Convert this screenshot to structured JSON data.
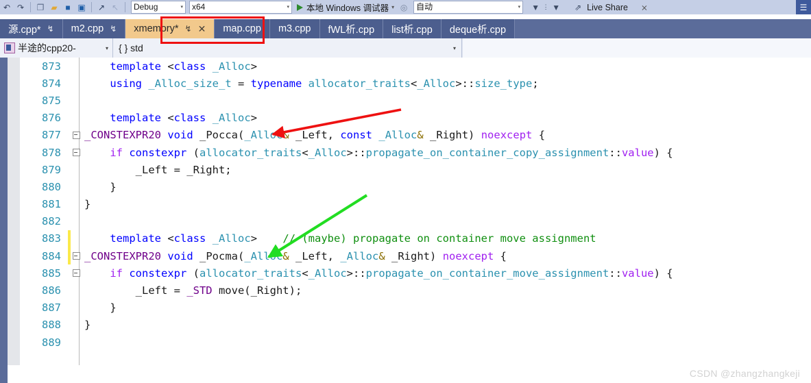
{
  "toolbar": {
    "config_combo": {
      "value": "Debug",
      "caret": "▾"
    },
    "platform_combo": {
      "value": "x64",
      "caret": "▾"
    },
    "run_label": "本地 Windows 调试器",
    "run_caret": "▾",
    "auto_combo": {
      "value": "自动",
      "caret": "▾"
    },
    "live_share_label": "Live Share",
    "icons": {
      "undo": "↶",
      "redo": "↷",
      "new_file": "❐",
      "open_folder": "▮",
      "save": "■",
      "save_all": "▣",
      "nav_forward": "↗",
      "nav_back": "↖",
      "shield": "◎",
      "filter_down": "▼",
      "dots": "⋮",
      "filter_down2": "▼",
      "share": "↗",
      "person": "✠",
      "menu": "≡"
    }
  },
  "tabs": [
    {
      "label": "源.cpp*",
      "pin": "↯",
      "close": "",
      "active": false
    },
    {
      "label": "m2.cpp",
      "pin": "↯",
      "close": "",
      "active": false
    },
    {
      "label": "xmemory*",
      "pin": "↯",
      "close": "✕",
      "active": true
    },
    {
      "label": "map.cpp",
      "pin": "",
      "close": "",
      "active": false
    },
    {
      "label": "m3.cpp",
      "pin": "",
      "close": "",
      "active": false
    },
    {
      "label": "fWL析.cpp",
      "pin": "",
      "close": "",
      "active": false
    },
    {
      "label": "list析.cpp",
      "pin": "",
      "close": "",
      "active": false
    },
    {
      "label": "deque析.cpp",
      "pin": "",
      "close": "",
      "active": false
    }
  ],
  "navbar": {
    "project": "半途的cpp20-",
    "project_caret": "▾",
    "scope": "{ } std",
    "scope_caret": "▾"
  },
  "code": {
    "lines": [
      {
        "no": "873",
        "fold": false,
        "changed": false,
        "tokens": [
          {
            "t": "    ",
            "c": "id"
          },
          {
            "t": "template",
            "c": "kw"
          },
          {
            "t": " ",
            "c": "id"
          },
          {
            "t": "<",
            "c": "op"
          },
          {
            "t": "class",
            "c": "kw"
          },
          {
            "t": " ",
            "c": "id"
          },
          {
            "t": "_Alloc",
            "c": "type"
          },
          {
            "t": ">",
            "c": "op"
          }
        ]
      },
      {
        "no": "874",
        "fold": false,
        "changed": false,
        "tokens": [
          {
            "t": "    ",
            "c": "id"
          },
          {
            "t": "using",
            "c": "kw"
          },
          {
            "t": " ",
            "c": "id"
          },
          {
            "t": "_Alloc_size_t",
            "c": "type"
          },
          {
            "t": " = ",
            "c": "op"
          },
          {
            "t": "typename",
            "c": "kw"
          },
          {
            "t": " ",
            "c": "id"
          },
          {
            "t": "allocator_traits",
            "c": "type"
          },
          {
            "t": "<",
            "c": "op"
          },
          {
            "t": "_Alloc",
            "c": "type"
          },
          {
            "t": ">::",
            "c": "op"
          },
          {
            "t": "size_type",
            "c": "type"
          },
          {
            "t": ";",
            "c": "op"
          }
        ]
      },
      {
        "no": "875",
        "fold": false,
        "changed": false,
        "tokens": []
      },
      {
        "no": "876",
        "fold": false,
        "changed": false,
        "tokens": [
          {
            "t": "    ",
            "c": "id"
          },
          {
            "t": "template",
            "c": "kw"
          },
          {
            "t": " ",
            "c": "id"
          },
          {
            "t": "<",
            "c": "op"
          },
          {
            "t": "class",
            "c": "kw"
          },
          {
            "t": " ",
            "c": "id"
          },
          {
            "t": "_Alloc",
            "c": "type"
          },
          {
            "t": ">",
            "c": "op"
          }
        ]
      },
      {
        "no": "877",
        "fold": true,
        "changed": false,
        "tokens": [
          {
            "t": "_CONSTEXPR20",
            "c": "macro"
          },
          {
            "t": " ",
            "c": "id"
          },
          {
            "t": "void",
            "c": "kw"
          },
          {
            "t": " ",
            "c": "id"
          },
          {
            "t": "_Pocca",
            "c": "fn"
          },
          {
            "t": "(",
            "c": "op"
          },
          {
            "t": "_Alloc",
            "c": "type"
          },
          {
            "t": "&",
            "c": "amp"
          },
          {
            "t": " _Left, ",
            "c": "op"
          },
          {
            "t": "const",
            "c": "kw"
          },
          {
            "t": " ",
            "c": "id"
          },
          {
            "t": "_Alloc",
            "c": "type"
          },
          {
            "t": "&",
            "c": "amp"
          },
          {
            "t": " _Right) ",
            "c": "op"
          },
          {
            "t": "noexcept",
            "c": "kw2"
          },
          {
            "t": " {",
            "c": "op"
          }
        ]
      },
      {
        "no": "878",
        "fold": true,
        "changed": false,
        "tokens": [
          {
            "t": "    ",
            "c": "id"
          },
          {
            "t": "if",
            "c": "kw2"
          },
          {
            "t": " ",
            "c": "id"
          },
          {
            "t": "constexpr",
            "c": "kw"
          },
          {
            "t": " (",
            "c": "op"
          },
          {
            "t": "allocator_traits",
            "c": "type"
          },
          {
            "t": "<",
            "c": "op"
          },
          {
            "t": "_Alloc",
            "c": "type"
          },
          {
            "t": ">::",
            "c": "op"
          },
          {
            "t": "propagate_on_container_copy_assignment",
            "c": "mem"
          },
          {
            "t": "::",
            "c": "op"
          },
          {
            "t": "value",
            "c": "kw2"
          },
          {
            "t": ") {",
            "c": "op"
          }
        ]
      },
      {
        "no": "879",
        "fold": false,
        "changed": false,
        "tokens": [
          {
            "t": "        _Left = _Right;",
            "c": "op"
          }
        ]
      },
      {
        "no": "880",
        "fold": false,
        "changed": false,
        "tokens": [
          {
            "t": "    }",
            "c": "op"
          }
        ]
      },
      {
        "no": "881",
        "fold": false,
        "changed": false,
        "tokens": [
          {
            "t": "}",
            "c": "op"
          }
        ]
      },
      {
        "no": "882",
        "fold": false,
        "changed": false,
        "tokens": []
      },
      {
        "no": "883",
        "fold": false,
        "changed": true,
        "tokens": [
          {
            "t": "    ",
            "c": "id"
          },
          {
            "t": "template",
            "c": "kw"
          },
          {
            "t": " ",
            "c": "id"
          },
          {
            "t": "<",
            "c": "op"
          },
          {
            "t": "class",
            "c": "kw"
          },
          {
            "t": " ",
            "c": "id"
          },
          {
            "t": "_Alloc",
            "c": "type"
          },
          {
            "t": ">",
            "c": "op"
          },
          {
            "t": "    ",
            "c": "id"
          },
          {
            "t": "// (maybe) propagate on container move assignment",
            "c": "com"
          }
        ]
      },
      {
        "no": "884",
        "fold": true,
        "changed": true,
        "tokens": [
          {
            "t": "_CONSTEXPR20",
            "c": "macro"
          },
          {
            "t": " ",
            "c": "id"
          },
          {
            "t": "void",
            "c": "kw"
          },
          {
            "t": " ",
            "c": "id"
          },
          {
            "t": "_Pocma",
            "c": "fn"
          },
          {
            "t": "(",
            "c": "op"
          },
          {
            "t": "_Alloc",
            "c": "type"
          },
          {
            "t": "&",
            "c": "amp"
          },
          {
            "t": " _Left, ",
            "c": "op"
          },
          {
            "t": "_Alloc",
            "c": "type"
          },
          {
            "t": "&",
            "c": "amp"
          },
          {
            "t": " _Right) ",
            "c": "op"
          },
          {
            "t": "noexcept",
            "c": "kw2"
          },
          {
            "t": " {",
            "c": "op"
          }
        ]
      },
      {
        "no": "885",
        "fold": true,
        "changed": false,
        "tokens": [
          {
            "t": "    ",
            "c": "id"
          },
          {
            "t": "if",
            "c": "kw2"
          },
          {
            "t": " ",
            "c": "id"
          },
          {
            "t": "constexpr",
            "c": "kw"
          },
          {
            "t": " (",
            "c": "op"
          },
          {
            "t": "allocator_traits",
            "c": "type"
          },
          {
            "t": "<",
            "c": "op"
          },
          {
            "t": "_Alloc",
            "c": "type"
          },
          {
            "t": ">::",
            "c": "op"
          },
          {
            "t": "propagate_on_container_move_assignment",
            "c": "mem"
          },
          {
            "t": "::",
            "c": "op"
          },
          {
            "t": "value",
            "c": "kw2"
          },
          {
            "t": ") {",
            "c": "op"
          }
        ]
      },
      {
        "no": "886",
        "fold": false,
        "changed": false,
        "tokens": [
          {
            "t": "        _Left = ",
            "c": "op"
          },
          {
            "t": "_STD",
            "c": "macro"
          },
          {
            "t": " move(_Right);",
            "c": "op"
          }
        ]
      },
      {
        "no": "887",
        "fold": false,
        "changed": false,
        "tokens": [
          {
            "t": "    }",
            "c": "op"
          }
        ]
      },
      {
        "no": "888",
        "fold": false,
        "changed": false,
        "tokens": [
          {
            "t": "}",
            "c": "op"
          }
        ]
      },
      {
        "no": "889",
        "fold": false,
        "changed": false,
        "tokens": []
      }
    ]
  },
  "annotations": {
    "red_arrow": {
      "color": "#ee1111",
      "points": "from (585,160) to (393,198)"
    },
    "green_arrow": {
      "color": "#22dd22",
      "points": "from (535,285) to (388,378)"
    },
    "red_box": {
      "color": "#ee1111",
      "target_tab": "xmemory*"
    }
  },
  "watermark": "CSDN @zhangzhangkeji",
  "colors": {
    "tabstrip_bg": "#5b6c9a",
    "active_tab_bg": "#f2c98c",
    "toolbar_bg": "#c5cfe6",
    "annotation_red": "#ee1111",
    "annotation_green": "#22dd22",
    "lineno": "#2b91af",
    "comment_green": "#108f10"
  }
}
